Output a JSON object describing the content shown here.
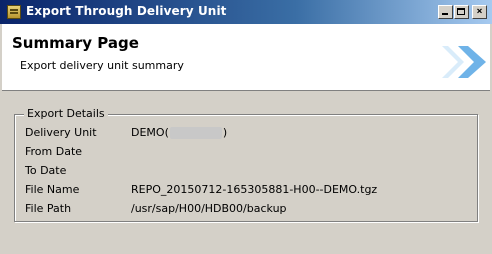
{
  "window": {
    "title": "Export Through Delivery Unit",
    "controls": [
      "minimize",
      "maximize",
      "close"
    ]
  },
  "header": {
    "title": "Summary Page",
    "subtitle": "Export delivery unit summary"
  },
  "export_details": {
    "legend": "Export Details",
    "rows": [
      {
        "label": "Delivery Unit",
        "value_prefix": "DEMO(",
        "value_suffix": ")"
      },
      {
        "label": "From Date",
        "value": ""
      },
      {
        "label": "To Date",
        "value": ""
      },
      {
        "label": "File Name",
        "value": "REPO_20150712-165305881-H00--DEMO.tgz"
      },
      {
        "label": "File Path",
        "value": "/usr/sap/H00/HDB00/backup"
      }
    ]
  }
}
